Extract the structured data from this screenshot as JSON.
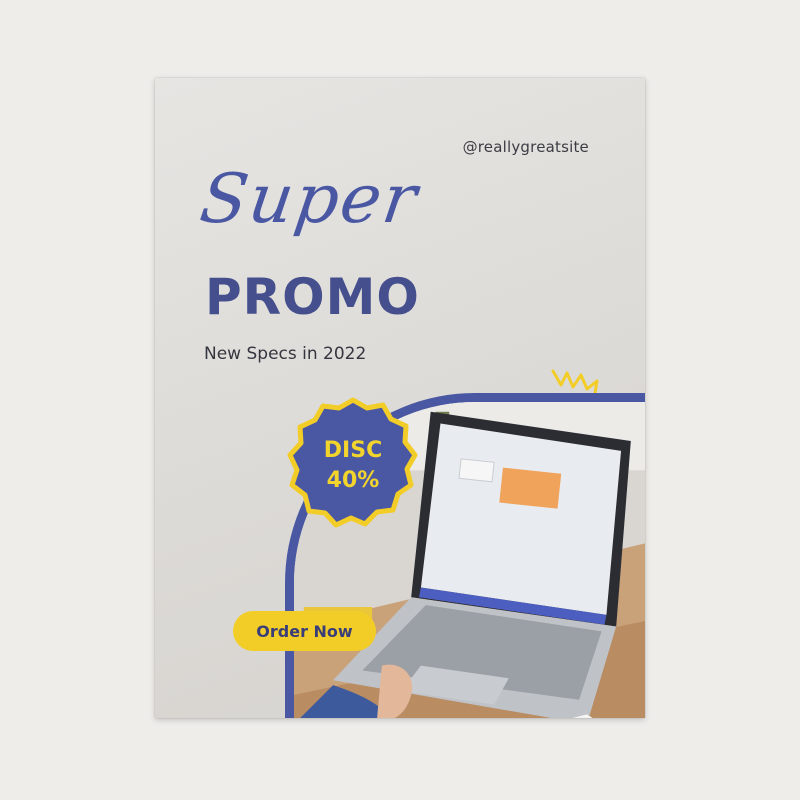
{
  "poster": {
    "handle": "@reallygreatsite",
    "script_title": "Super",
    "main_title": "PROMO",
    "subtitle": "New Specs in 2022",
    "badge": {
      "line1": "DISC",
      "line2": "40%"
    },
    "cta_label": "Order Now"
  },
  "colors": {
    "background": "#efedea",
    "poster": "#e3e1de",
    "brand_blue": "#4a58a3",
    "accent_yellow": "#f3cd27",
    "text_dark": "#35353f"
  },
  "icons": [
    "sparkle-icon"
  ]
}
